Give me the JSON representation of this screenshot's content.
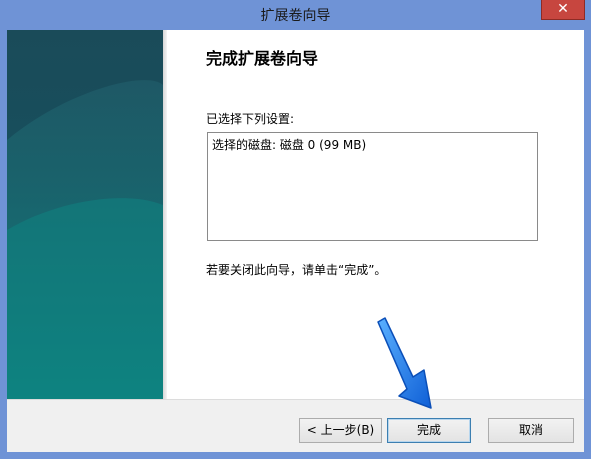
{
  "window": {
    "title": "扩展卷向导",
    "close_label": "✕"
  },
  "wizard": {
    "heading": "完成扩展卷向导",
    "settings_label": "已选择下列设置:",
    "settings_text": "选择的磁盘: 磁盘 0 (99 MB)",
    "finish_hint": "若要关闭此向导，请单击“完成”。"
  },
  "buttons": {
    "back": "< 上一步(B)",
    "finish": "完成",
    "cancel": "取消"
  },
  "colors": {
    "titlebar": "#6f93d6",
    "sidebar": "#1a4b59",
    "arrow": "#1e73e8"
  },
  "annotation": {
    "icon": "blue-arrow-pointing-to-finish"
  }
}
